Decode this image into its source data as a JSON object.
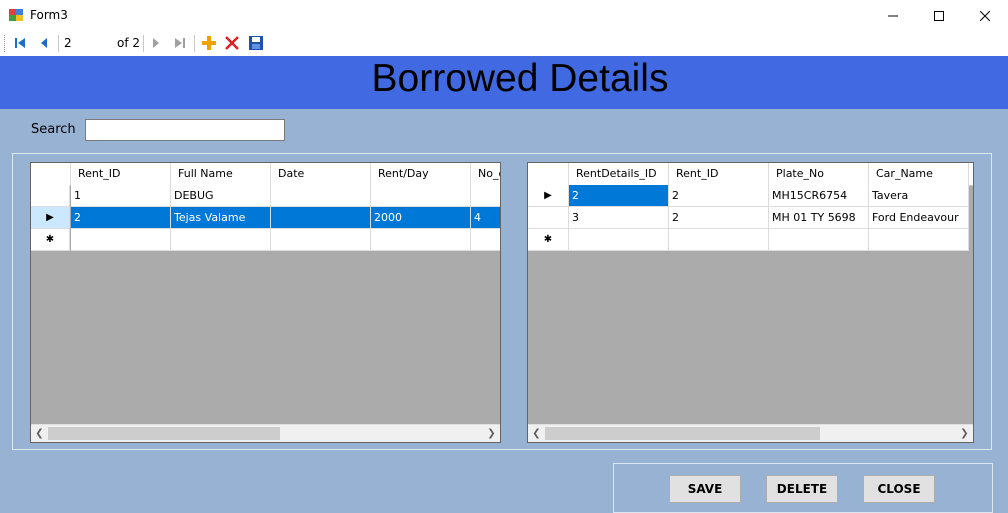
{
  "window": {
    "title": "Form3",
    "minimize_glyph": "—",
    "maximize_glyph": "☐",
    "close_glyph": "✕"
  },
  "navigator": {
    "position": "2",
    "of_label": "of 2"
  },
  "header": {
    "title": "Borrowed Details"
  },
  "search": {
    "label": "Search",
    "value": ""
  },
  "rent_grid": {
    "columns": [
      "Rent_ID",
      "Full Name",
      "Date",
      "Rent/Day",
      "No_o"
    ],
    "rows": [
      {
        "indicator": "",
        "cells": [
          "1",
          "DEBUG",
          "",
          "",
          ""
        ]
      },
      {
        "indicator": "▶",
        "cells": [
          "2",
          "Tejas Valame",
          "",
          "2000",
          "4"
        ]
      },
      {
        "indicator": "✱",
        "cells": [
          "",
          "",
          "",
          "",
          ""
        ]
      }
    ],
    "selected_row": 1
  },
  "details_grid": {
    "columns": [
      "RentDetails_ID",
      "Rent_ID",
      "Plate_No",
      "Car_Name"
    ],
    "rows": [
      {
        "indicator": "▶",
        "cells": [
          "2",
          "2",
          "MH15CR6754",
          "Tavera"
        ]
      },
      {
        "indicator": "",
        "cells": [
          "3",
          "2",
          "MH 01 TY 5698",
          "Ford Endeavour"
        ]
      },
      {
        "indicator": "✱",
        "cells": [
          "",
          "",
          "",
          ""
        ]
      }
    ],
    "selected_cell": [
      0,
      0
    ]
  },
  "buttons": {
    "save": "SAVE",
    "delete": "DELETE",
    "close": "CLOSE"
  },
  "colors": {
    "header_bg": "#4169e1",
    "form_bg": "#98b2d4",
    "selection": "#0078d7"
  }
}
